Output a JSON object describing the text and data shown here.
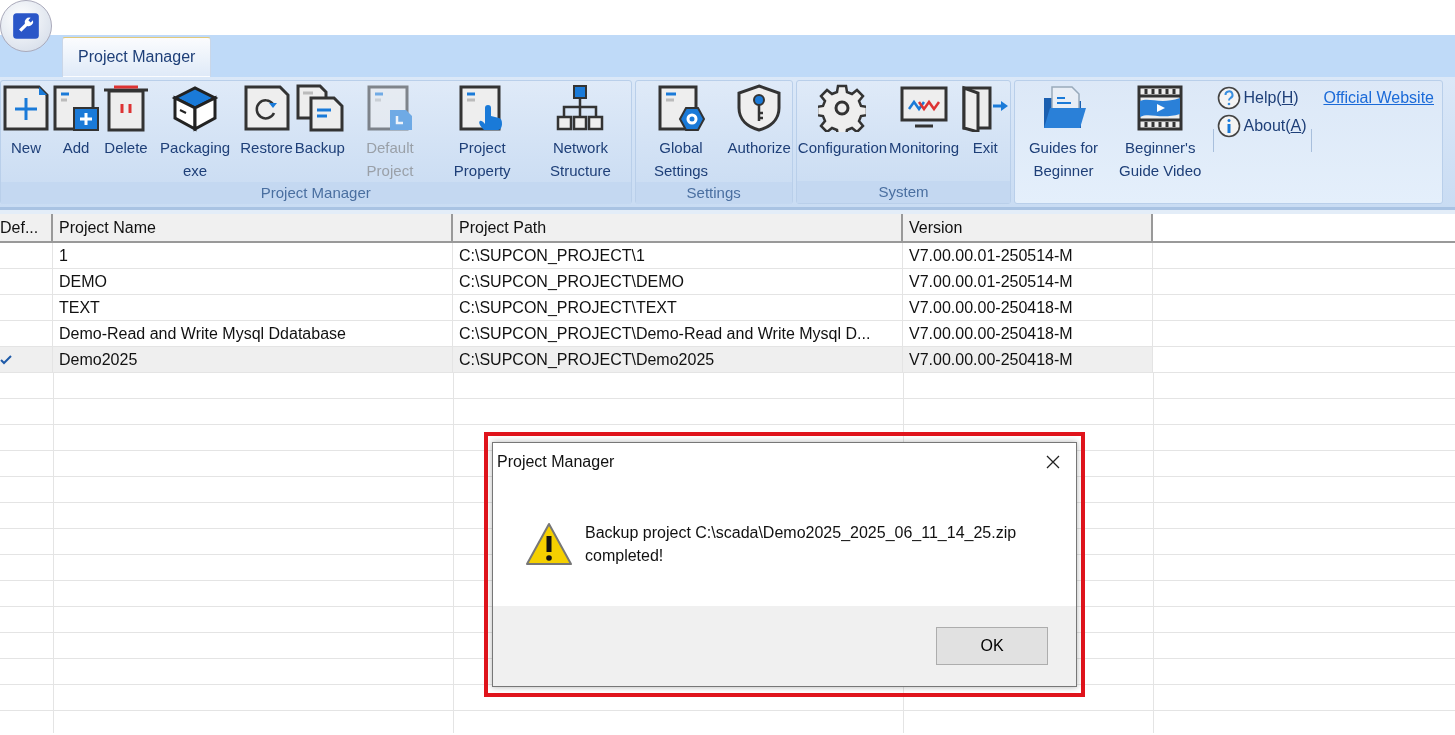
{
  "tabs": [
    {
      "label": "Project Manager",
      "selected": true
    }
  ],
  "ribbon": {
    "groups": [
      {
        "label": "Project Manager",
        "buttons": [
          {
            "label": "New",
            "kind": "new",
            "disabled": false
          },
          {
            "label": "Add",
            "kind": "add",
            "disabled": false
          },
          {
            "label": "Delete",
            "kind": "delete",
            "disabled": false
          },
          {
            "label": "Packaging exe",
            "kind": "package",
            "disabled": false
          },
          {
            "label": "Restore",
            "kind": "restore",
            "disabled": false
          },
          {
            "label": "Backup",
            "kind": "backup",
            "disabled": false
          },
          {
            "label": "Default Project",
            "kind": "default",
            "disabled": true
          },
          {
            "label": "Project Property",
            "kind": "property",
            "disabled": false
          },
          {
            "label": "Network Structure",
            "kind": "network",
            "disabled": false
          }
        ]
      },
      {
        "label": "Settings",
        "buttons": [
          {
            "label": "Global Settings",
            "kind": "global",
            "disabled": false
          },
          {
            "label": "Authorize",
            "kind": "authorize",
            "disabled": false
          }
        ]
      },
      {
        "label": "System",
        "buttons": [
          {
            "label": "Configuration",
            "kind": "gear",
            "disabled": false
          },
          {
            "label": "Monitoring",
            "kind": "monitor",
            "disabled": false
          },
          {
            "label": "Exit",
            "kind": "exit",
            "disabled": false
          }
        ]
      },
      {
        "buttons": [
          {
            "label": "Guides for Beginner",
            "kind": "folder",
            "disabled": false
          },
          {
            "label": "Beginner's Guide Video",
            "kind": "video",
            "disabled": false
          }
        ],
        "small_buttons": [
          {
            "before": "Help(",
            "accelerator": "H",
            "after": ")",
            "kind": "help"
          },
          {
            "before": "About(",
            "accelerator": "A",
            "after": ")",
            "kind": "info"
          }
        ],
        "link": "Official Website"
      }
    ]
  },
  "table": {
    "columns": [
      "Def...",
      "Project Name",
      "Project Path",
      "Version"
    ],
    "rows": [
      {
        "default": false,
        "selected": false,
        "name": "1",
        "path": "C:\\SUPCON_PROJECT\\1",
        "version": "V7.00.00.01-250514-M"
      },
      {
        "default": false,
        "selected": false,
        "name": "DEMO",
        "path": "C:\\SUPCON_PROJECT\\DEMO",
        "version": "V7.00.00.01-250514-M"
      },
      {
        "default": false,
        "selected": false,
        "name": "TEXT",
        "path": "C:\\SUPCON_PROJECT\\TEXT",
        "version": "V7.00.00.00-250418-M"
      },
      {
        "default": false,
        "selected": false,
        "name": "Demo-Read and Write Mysql Ddatabase",
        "path": "C:\\SUPCON_PROJECT\\Demo-Read and Write Mysql D...",
        "version": "V7.00.00.00-250418-M"
      },
      {
        "default": true,
        "selected": true,
        "name": "Demo2025",
        "path": "C:\\SUPCON_PROJECT\\Demo2025",
        "version": "V7.00.00.00-250418-M"
      }
    ]
  },
  "dialog": {
    "title": "Project Manager",
    "message": "Backup project C:\\scada\\Demo2025_2025_06_11_14_25.zip completed!",
    "buttons": [
      "OK"
    ]
  }
}
